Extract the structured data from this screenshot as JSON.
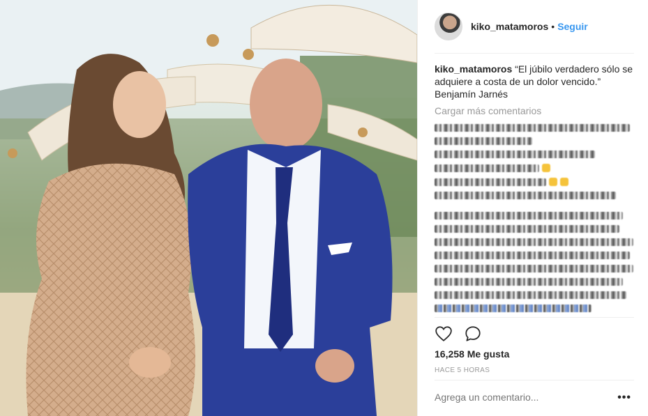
{
  "post": {
    "username": "kiko_matamoros",
    "separator": "•",
    "follow_label": "Seguir",
    "caption": "“El júbilo verdadero sólo se adquiere a costa de un dolor vencido.” Benjamín Jarnés",
    "load_more_label": "Cargar más comentarios",
    "likes_count": "16,258",
    "likes_label": "Me gusta",
    "time_ago": "HACE 5 HORAS",
    "comment_placeholder": "Agrega un comentario...",
    "more_options": "•••"
  },
  "icons": {
    "like": "heart-icon",
    "comment": "comment-bubble-icon",
    "options": "more-horizontal-icon"
  },
  "colors": {
    "link": "#3897f0",
    "text": "#262626",
    "muted": "#999999"
  }
}
